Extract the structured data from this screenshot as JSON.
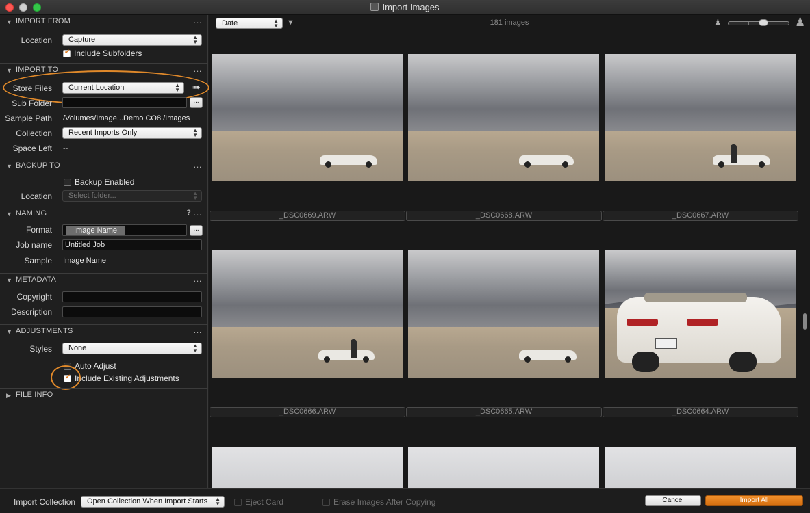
{
  "window": {
    "title": "Import Images"
  },
  "import_from": {
    "header": "IMPORT FROM",
    "location_label": "Location",
    "location_value": "Capture",
    "include_subfolders_label": "Include Subfolders",
    "include_subfolders_checked": true
  },
  "import_to": {
    "header": "IMPORT TO",
    "store_files_label": "Store Files",
    "store_files_value": "Current Location",
    "sub_folder_label": "Sub Folder",
    "sub_folder_btn": "...",
    "sample_path_label": "Sample Path",
    "sample_path_value": "/Volumes/Image...Demo CO8 /Images",
    "collection_label": "Collection",
    "collection_value": "Recent Imports Only",
    "space_left_label": "Space Left",
    "space_left_value": "--"
  },
  "backup_to": {
    "header": "BACKUP TO",
    "backup_enabled_label": "Backup Enabled",
    "backup_enabled_checked": false,
    "location_label": "Location",
    "location_placeholder": "Select folder..."
  },
  "naming": {
    "header": "NAMING",
    "help": "?",
    "format_label": "Format",
    "format_token": "Image Name",
    "format_btn": "...",
    "job_name_label": "Job name",
    "job_name_value": "Untitled Job",
    "sample_label": "Sample",
    "sample_value": "Image Name"
  },
  "metadata": {
    "header": "METADATA",
    "copyright_label": "Copyright",
    "description_label": "Description"
  },
  "adjustments": {
    "header": "ADJUSTMENTS",
    "styles_label": "Styles",
    "styles_value": "None",
    "auto_adjust_label": "Auto Adjust",
    "auto_adjust_checked": false,
    "include_existing_label": "Include Existing Adjustments",
    "include_existing_checked": true
  },
  "file_info": {
    "header": "FILE INFO"
  },
  "section_menu": "…",
  "browser": {
    "sort_value": "Date",
    "image_count": "181 images",
    "thumbnail_size": 0.55,
    "files": [
      "_DSC0669.ARW",
      "_DSC0668.ARW",
      "_DSC0667.ARW",
      "_DSC0666.ARW",
      "_DSC0665.ARW",
      "_DSC0664.ARW"
    ]
  },
  "bottom": {
    "import_collection_label": "Import Collection",
    "import_collection_value": "Open Collection When Import Starts",
    "eject_card_label": "Eject Card",
    "erase_label": "Erase Images After Copying",
    "cancel_label": "Cancel",
    "import_all_label": "Import All"
  },
  "colors": {
    "accent": "#e0892a",
    "primary_button": "#e07b1c"
  }
}
